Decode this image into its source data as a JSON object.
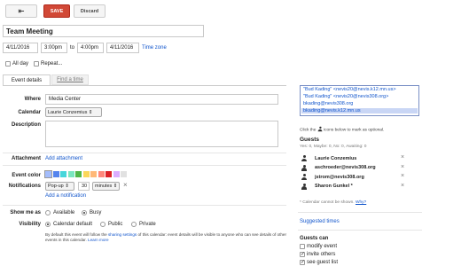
{
  "toolbar": {
    "back_glyph": "⇤",
    "save_label": "SAVE",
    "discard_label": "Discard"
  },
  "event": {
    "title": "Team Meeting",
    "start_date": "4/11/2016",
    "start_time": "3:00pm",
    "to_label": "to",
    "end_time": "4:00pm",
    "end_date": "4/11/2016",
    "timezone_link": "Time zone",
    "allday_label": "All day",
    "repeat_label": "Repeat..."
  },
  "tabs": {
    "details": "Event details",
    "find_time": "Find a time"
  },
  "details": {
    "where_label": "Where",
    "where_value": "Media Center",
    "calendar_label": "Calendar",
    "calendar_value": "Laurie Conzemius ⇕",
    "description_label": "Description",
    "attachment_label": "Attachment",
    "attachment_link": "Add attachment",
    "event_color_label": "Event color",
    "notifications_label": "Notifications",
    "notif_method": "Pop-up ⇕",
    "notif_amount": "30",
    "notif_unit": "minutes ⇕",
    "notif_remove": "×",
    "add_notification": "Add a notification",
    "showme_label": "Show me as",
    "available_label": "Available",
    "busy_label": "Busy",
    "visibility_label": "Visibility",
    "vis_default": "Calendar default",
    "vis_public": "Public",
    "vis_private": "Private",
    "vis_note_1": "By default this event will follow the",
    "vis_note_link": "sharing settings",
    "vis_note_2": "of this calendar: event details will be visible to anyone who",
    "vis_note_3": "can see details of other events in this calendar.",
    "learn_more": "Learn more"
  },
  "colors": [
    "#a4bdfc",
    "#5484ed",
    "#46d6db",
    "#7ae7bf",
    "#51b749",
    "#fbd75b",
    "#ffb878",
    "#ff887c",
    "#dc2127",
    "#dbadff",
    "#e1e1e1"
  ],
  "autocomplete": [
    "\"Bud Kading\" <nevis20@nevis.k12.mn.us>",
    "\"Bud Kading\" <nevis20@nevis308.org>",
    "bkading@nevis308.org",
    "bkading@nevis.k12.mn.us"
  ],
  "guests": {
    "hint_before": "Click the",
    "hint_after": "icons below to mark as optional.",
    "title": "Guests",
    "summary": "Yes: 0, Maybe: 0, No: 0, Awaiting: 0",
    "list": [
      "Laurie Conzemius",
      "aschroeder@nevis308.org",
      "jstrom@nevis308.org",
      "Sharon Gunkel *"
    ],
    "remove": "×",
    "cannot_shown": "* Calendar cannot be shown.",
    "why": "Why?",
    "suggested": "Suggested times",
    "can_title": "Guests can",
    "perm_modify": "modify event",
    "perm_invite": "invite others",
    "perm_see": "see guest list"
  }
}
